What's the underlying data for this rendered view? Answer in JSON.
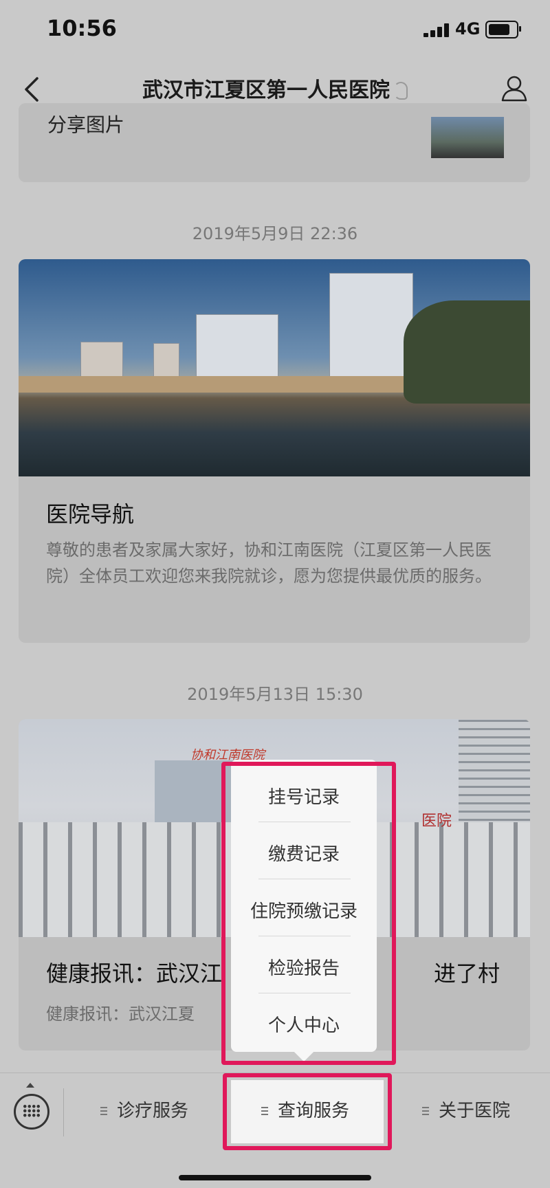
{
  "status_bar": {
    "time": "10:56",
    "network": "4G"
  },
  "nav": {
    "title": "武汉市江夏区第一人民医院"
  },
  "feed": {
    "top_card_text": "分享图片",
    "timestamp_1": "2019年5月9日 22:36",
    "card_1": {
      "title": "医院导航",
      "desc": "尊敬的患者及家属大家好，协和江南医院（江夏区第一人民医院）全体员工欢迎您来我院就诊，愿为您提供最优质的服务。"
    },
    "timestamp_2": "2019年5月13日 15:30",
    "card_2": {
      "title_left": "健康报讯：武汉江",
      "title_right": "进了村",
      "desc": "健康报讯：武汉江夏",
      "photo_text": "医院",
      "photo_sign": "协和江南医院"
    }
  },
  "popup_menu": {
    "items": [
      "挂号记录",
      "缴费记录",
      "住院预缴记录",
      "检验报告",
      "个人中心"
    ]
  },
  "tab_bar": {
    "tabs": [
      "诊疗服务",
      "查询服务",
      "关于医院"
    ],
    "active": "查询服务"
  },
  "colors": {
    "highlight": "#e0185a"
  }
}
